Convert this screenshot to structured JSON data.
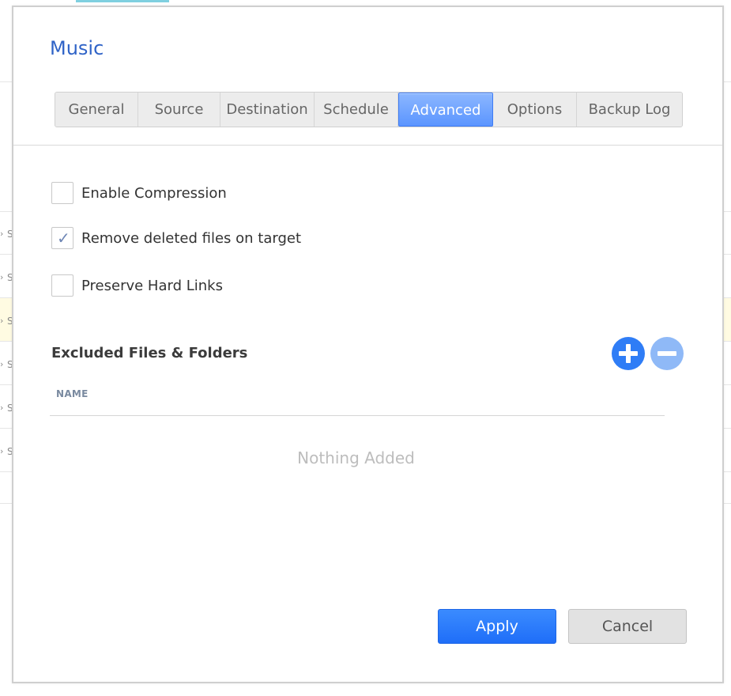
{
  "dialog": {
    "title": "Music",
    "tabs": [
      {
        "label": "General"
      },
      {
        "label": "Source"
      },
      {
        "label": "Destination"
      },
      {
        "label": "Schedule"
      },
      {
        "label": "Advanced",
        "active": true
      },
      {
        "label": "Options"
      },
      {
        "label": "Backup Log"
      }
    ],
    "options": [
      {
        "label": "Enable Compression",
        "checked": false
      },
      {
        "label": "Remove deleted files on target",
        "checked": true
      },
      {
        "label": "Preserve Hard Links",
        "checked": false
      }
    ],
    "excluded": {
      "title": "Excluded Files & Folders",
      "column_header": "NAME",
      "empty_text": "Nothing Added",
      "add_icon": "plus-circle-icon",
      "remove_icon": "minus-circle-icon"
    },
    "buttons": {
      "apply": "Apply",
      "cancel": "Cancel"
    }
  },
  "background": {
    "row_arrow": "›",
    "row_letter": "S"
  },
  "colors": {
    "accent": "#2f7df6",
    "title": "#2f63c7",
    "active_tab": "#5b95ff"
  }
}
